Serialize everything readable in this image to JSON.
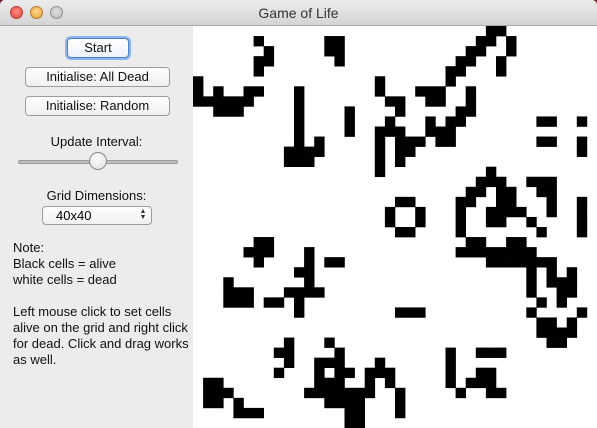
{
  "window": {
    "title": "Game of Life"
  },
  "controls": {
    "start_label": "Start",
    "init_dead_label": "Initialise: All Dead",
    "init_random_label": "Initialise: Random",
    "update_interval_label": "Update Interval:",
    "update_interval_value": 0.5,
    "grid_dimensions_label": "Grid Dimensions:",
    "grid_dimensions_value": "40x40"
  },
  "note": {
    "heading": "Note:",
    "line_black": "Black cells = alive",
    "line_white": "white cells = dead",
    "instructions": "Left mouse click to set cells alive on the grid and right click for dead. Click and drag works as well."
  },
  "grid": {
    "rows": 40,
    "cols": 40,
    "alive_color": "#000000",
    "dead_color": "#ffffff",
    "alive": [
      [
        0,
        29
      ],
      [
        0,
        30
      ],
      [
        1,
        6
      ],
      [
        1,
        13
      ],
      [
        1,
        14
      ],
      [
        1,
        28
      ],
      [
        1,
        29
      ],
      [
        1,
        31
      ],
      [
        2,
        7
      ],
      [
        2,
        13
      ],
      [
        2,
        14
      ],
      [
        2,
        27
      ],
      [
        2,
        28
      ],
      [
        2,
        31
      ],
      [
        3,
        6
      ],
      [
        3,
        7
      ],
      [
        3,
        14
      ],
      [
        3,
        26
      ],
      [
        3,
        27
      ],
      [
        3,
        30
      ],
      [
        4,
        6
      ],
      [
        4,
        25
      ],
      [
        4,
        26
      ],
      [
        4,
        30
      ],
      [
        5,
        0
      ],
      [
        5,
        18
      ],
      [
        5,
        25
      ],
      [
        6,
        0
      ],
      [
        6,
        2
      ],
      [
        6,
        5
      ],
      [
        6,
        6
      ],
      [
        6,
        10
      ],
      [
        6,
        18
      ],
      [
        6,
        22
      ],
      [
        6,
        23
      ],
      [
        6,
        24
      ],
      [
        6,
        27
      ],
      [
        7,
        0
      ],
      [
        7,
        1
      ],
      [
        7,
        2
      ],
      [
        7,
        3
      ],
      [
        7,
        4
      ],
      [
        7,
        5
      ],
      [
        7,
        10
      ],
      [
        7,
        19
      ],
      [
        7,
        20
      ],
      [
        7,
        23
      ],
      [
        7,
        24
      ],
      [
        7,
        27
      ],
      [
        8,
        2
      ],
      [
        8,
        3
      ],
      [
        8,
        4
      ],
      [
        8,
        10
      ],
      [
        8,
        15
      ],
      [
        8,
        20
      ],
      [
        8,
        26
      ],
      [
        8,
        27
      ],
      [
        9,
        10
      ],
      [
        9,
        15
      ],
      [
        9,
        19
      ],
      [
        9,
        23
      ],
      [
        9,
        25
      ],
      [
        9,
        26
      ],
      [
        9,
        34
      ],
      [
        9,
        35
      ],
      [
        9,
        38
      ],
      [
        10,
        10
      ],
      [
        10,
        15
      ],
      [
        10,
        18
      ],
      [
        10,
        19
      ],
      [
        10,
        20
      ],
      [
        10,
        23
      ],
      [
        10,
        24
      ],
      [
        10,
        25
      ],
      [
        11,
        10
      ],
      [
        11,
        12
      ],
      [
        11,
        18
      ],
      [
        11,
        20
      ],
      [
        11,
        21
      ],
      [
        11,
        22
      ],
      [
        11,
        24
      ],
      [
        11,
        25
      ],
      [
        11,
        34
      ],
      [
        11,
        35
      ],
      [
        11,
        38
      ],
      [
        12,
        9
      ],
      [
        12,
        10
      ],
      [
        12,
        11
      ],
      [
        12,
        12
      ],
      [
        12,
        18
      ],
      [
        12,
        20
      ],
      [
        12,
        21
      ],
      [
        12,
        38
      ],
      [
        13,
        9
      ],
      [
        13,
        10
      ],
      [
        13,
        11
      ],
      [
        13,
        18
      ],
      [
        13,
        20
      ],
      [
        14,
        18
      ],
      [
        14,
        29
      ],
      [
        15,
        28
      ],
      [
        15,
        29
      ],
      [
        15,
        30
      ],
      [
        15,
        33
      ],
      [
        15,
        34
      ],
      [
        15,
        35
      ],
      [
        16,
        27
      ],
      [
        16,
        28
      ],
      [
        16,
        30
      ],
      [
        16,
        31
      ],
      [
        16,
        34
      ],
      [
        16,
        35
      ],
      [
        17,
        20
      ],
      [
        17,
        21
      ],
      [
        17,
        26
      ],
      [
        17,
        27
      ],
      [
        17,
        30
      ],
      [
        17,
        31
      ],
      [
        17,
        35
      ],
      [
        17,
        38
      ],
      [
        18,
        19
      ],
      [
        18,
        22
      ],
      [
        18,
        26
      ],
      [
        18,
        29
      ],
      [
        18,
        30
      ],
      [
        18,
        31
      ],
      [
        18,
        32
      ],
      [
        18,
        35
      ],
      [
        18,
        38
      ],
      [
        19,
        19
      ],
      [
        19,
        22
      ],
      [
        19,
        26
      ],
      [
        19,
        29
      ],
      [
        19,
        30
      ],
      [
        19,
        33
      ],
      [
        19,
        38
      ],
      [
        20,
        20
      ],
      [
        20,
        21
      ],
      [
        20,
        26
      ],
      [
        20,
        34
      ],
      [
        20,
        38
      ],
      [
        21,
        6
      ],
      [
        21,
        7
      ],
      [
        21,
        27
      ],
      [
        21,
        28
      ],
      [
        21,
        31
      ],
      [
        21,
        32
      ],
      [
        22,
        5
      ],
      [
        22,
        6
      ],
      [
        22,
        7
      ],
      [
        22,
        11
      ],
      [
        22,
        26
      ],
      [
        22,
        27
      ],
      [
        22,
        28
      ],
      [
        22,
        29
      ],
      [
        22,
        30
      ],
      [
        22,
        31
      ],
      [
        22,
        32
      ],
      [
        22,
        33
      ],
      [
        23,
        6
      ],
      [
        23,
        11
      ],
      [
        23,
        13
      ],
      [
        23,
        14
      ],
      [
        23,
        29
      ],
      [
        23,
        30
      ],
      [
        23,
        31
      ],
      [
        23,
        32
      ],
      [
        23,
        33
      ],
      [
        23,
        34
      ],
      [
        23,
        35
      ],
      [
        24,
        10
      ],
      [
        24,
        11
      ],
      [
        24,
        33
      ],
      [
        24,
        35
      ],
      [
        24,
        37
      ],
      [
        25,
        3
      ],
      [
        25,
        11
      ],
      [
        25,
        33
      ],
      [
        25,
        35
      ],
      [
        25,
        36
      ],
      [
        25,
        37
      ],
      [
        26,
        3
      ],
      [
        26,
        4
      ],
      [
        26,
        5
      ],
      [
        26,
        9
      ],
      [
        26,
        10
      ],
      [
        26,
        11
      ],
      [
        26,
        12
      ],
      [
        26,
        33
      ],
      [
        26,
        36
      ],
      [
        26,
        37
      ],
      [
        27,
        3
      ],
      [
        27,
        4
      ],
      [
        27,
        5
      ],
      [
        27,
        7
      ],
      [
        27,
        8
      ],
      [
        27,
        10
      ],
      [
        27,
        34
      ],
      [
        27,
        36
      ],
      [
        28,
        10
      ],
      [
        28,
        20
      ],
      [
        28,
        21
      ],
      [
        28,
        22
      ],
      [
        28,
        33
      ],
      [
        28,
        38
      ],
      [
        29,
        34
      ],
      [
        29,
        35
      ],
      [
        29,
        37
      ],
      [
        30,
        34
      ],
      [
        30,
        35
      ],
      [
        30,
        36
      ],
      [
        30,
        37
      ],
      [
        31,
        9
      ],
      [
        31,
        13
      ],
      [
        31,
        35
      ],
      [
        31,
        36
      ],
      [
        32,
        8
      ],
      [
        32,
        9
      ],
      [
        32,
        14
      ],
      [
        32,
        25
      ],
      [
        32,
        28
      ],
      [
        32,
        29
      ],
      [
        32,
        30
      ],
      [
        33,
        9
      ],
      [
        33,
        12
      ],
      [
        33,
        13
      ],
      [
        33,
        14
      ],
      [
        33,
        18
      ],
      [
        33,
        25
      ],
      [
        34,
        8
      ],
      [
        34,
        12
      ],
      [
        34,
        14
      ],
      [
        34,
        15
      ],
      [
        34,
        17
      ],
      [
        34,
        18
      ],
      [
        34,
        19
      ],
      [
        34,
        25
      ],
      [
        34,
        28
      ],
      [
        34,
        29
      ],
      [
        35,
        1
      ],
      [
        35,
        2
      ],
      [
        35,
        12
      ],
      [
        35,
        13
      ],
      [
        35,
        14
      ],
      [
        35,
        17
      ],
      [
        35,
        19
      ],
      [
        35,
        25
      ],
      [
        35,
        27
      ],
      [
        35,
        28
      ],
      [
        35,
        29
      ],
      [
        36,
        1
      ],
      [
        36,
        2
      ],
      [
        36,
        3
      ],
      [
        36,
        11
      ],
      [
        36,
        12
      ],
      [
        36,
        13
      ],
      [
        36,
        14
      ],
      [
        36,
        15
      ],
      [
        36,
        16
      ],
      [
        36,
        17
      ],
      [
        36,
        20
      ],
      [
        36,
        26
      ],
      [
        36,
        29
      ],
      [
        36,
        30
      ],
      [
        37,
        1
      ],
      [
        37,
        2
      ],
      [
        37,
        4
      ],
      [
        37,
        13
      ],
      [
        37,
        14
      ],
      [
        37,
        15
      ],
      [
        37,
        16
      ],
      [
        37,
        20
      ],
      [
        38,
        4
      ],
      [
        38,
        5
      ],
      [
        38,
        6
      ],
      [
        38,
        15
      ],
      [
        38,
        16
      ],
      [
        38,
        20
      ],
      [
        39,
        15
      ],
      [
        39,
        16
      ]
    ]
  }
}
